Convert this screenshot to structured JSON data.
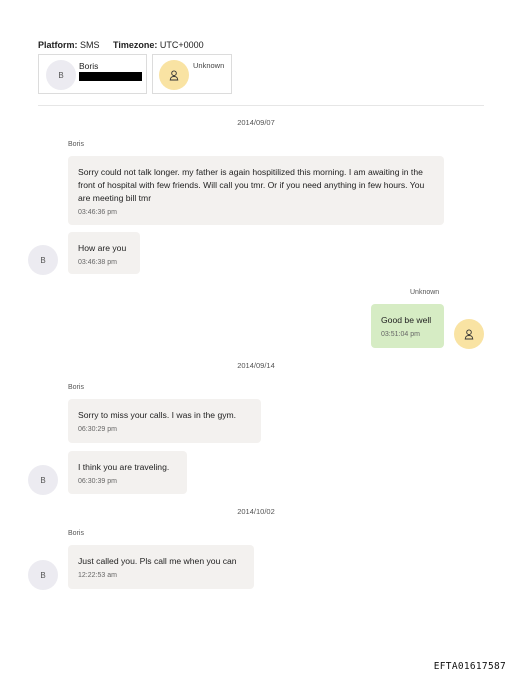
{
  "header": {
    "platform_label": "Platform:",
    "platform_value": "SMS",
    "timezone_label": "Timezone:",
    "timezone_value": "UTC+0000"
  },
  "participants": [
    {
      "initial": "B",
      "name": "Boris",
      "number_redacted": true
    },
    {
      "name": "Unknown"
    }
  ],
  "conversation": [
    {
      "date": "2014/09/07"
    },
    {
      "sender": "Boris",
      "text": "Sorry could not talk longer.   my father is again hospitilized this morning.   I am awaiting in the front of hospital with few friends.  Will call you tmr.  Or if you need anything in few hours.  You are meeting bill tmr",
      "time": "03:46:36 pm"
    },
    {
      "text": "How are you",
      "time": "03:46:38 pm",
      "avatar": "B"
    },
    {
      "sender": "Unknown",
      "text": "Good be well",
      "time": "03:51:04 pm"
    },
    {
      "date": "2014/09/14"
    },
    {
      "sender": "Boris",
      "text": "Sorry to miss your calls. I was in the gym.",
      "time": "06:30:29 pm"
    },
    {
      "text": "I think you are traveling.",
      "time": "06:30:39 pm",
      "avatar": "B"
    },
    {
      "date": "2014/10/02"
    },
    {
      "sender": "Boris",
      "text": "Just called you. Pls call me when you can",
      "time": "12:22:53 am",
      "avatar": "B"
    }
  ],
  "footer_id": "EFTA01617587"
}
